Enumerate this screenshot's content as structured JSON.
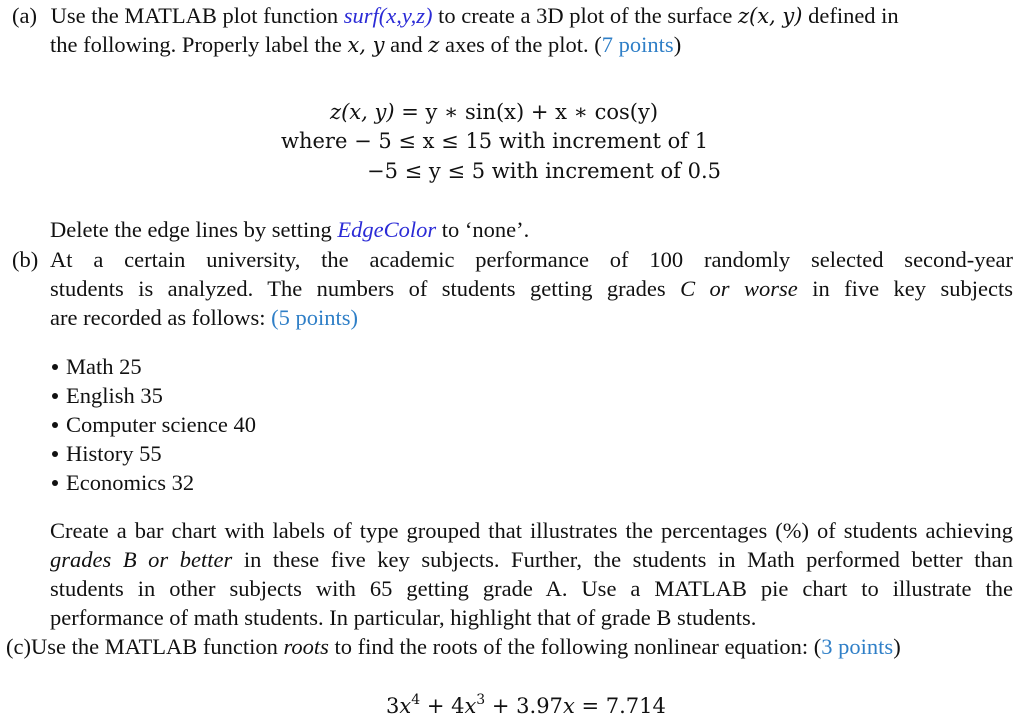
{
  "part_a": {
    "label": "(a)",
    "line1_pre": "Use the MATLAB plot function ",
    "function_name": "surf(x,y,z)",
    "line1_post": " to create a 3D plot of the surface ",
    "surface_ref": "z(x, y)",
    "line1_end": " defined in",
    "line2_pre": "the following. Properly label the ",
    "axes_ref": "x, y",
    "line2_and": " and ",
    "axis_z": "z",
    "line2_post": " axes of the plot. (",
    "points": "7 points",
    "line2_close": ")",
    "equation_lhs": "z(x, y)",
    "equation_rhs": " = y ∗ sin(x) + x ∗ cos(y)",
    "where_label": "where",
    "range_x": " − 5 ≤ x ≤ 15 with increment of 1",
    "range_y": "−5 ≤ y ≤ 5 with increment of 0.5",
    "delete_pre": "Delete the edge lines by setting ",
    "edge_color": "EdgeColor",
    "delete_post": " to ‘none’."
  },
  "part_b": {
    "label": "(b)",
    "line1": "At a certain university, the academic performance of 100 randomly selected second-year",
    "line2_pre": "students is analyzed. The numbers of students getting grades ",
    "grade_phrase": "C or worse",
    "line2_post": " in five key subjects",
    "line3_pre": "are recorded as follows: ",
    "points_open": "(",
    "points": "5 points",
    "points_close": ")",
    "subjects": [
      {
        "name": "Math",
        "count": "25"
      },
      {
        "name": "English",
        "count": "35"
      },
      {
        "name": "Computer science",
        "count": "40"
      },
      {
        "name": "History",
        "count": "55"
      },
      {
        "name": "Economics",
        "count": "32"
      }
    ],
    "para_line1": "Create a bar chart with labels of type grouped that illustrates the percentages (%) of students achieving",
    "para_line2_it": "grades B or better",
    "para_line2_post": " in these five key subjects. Further, the students in Math performed better than",
    "para_line3": "students in other subjects with 65 getting grade A. Use a MATLAB pie chart to illustrate the",
    "para_line4": "performance of math students. In particular, highlight that of grade B students."
  },
  "part_c": {
    "label": "(c)",
    "line_pre": "Use the MATLAB function ",
    "function_name": "roots",
    "line_post": " to find the roots of the following nonlinear equation: (",
    "points": "3 points",
    "line_close": ")",
    "eq_coef1": "3",
    "eq_exp1": "4",
    "eq_mid1": " + 4",
    "eq_exp2": "3",
    "eq_mid2": " + 3.97",
    "eq_rhs": " = 7.714"
  }
}
